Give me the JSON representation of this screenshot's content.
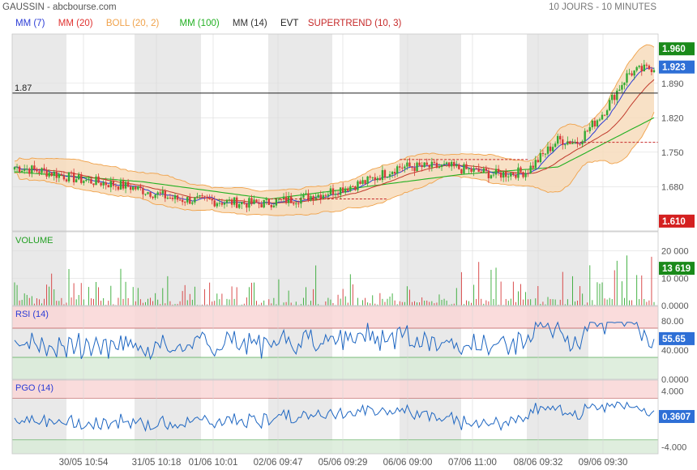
{
  "header": {
    "title": "GAUSSIN - abcbourse.com",
    "period": "10 JOURS - 10 MINUTES"
  },
  "legend": [
    {
      "label": "MM (7)",
      "color": "#2b3cd6"
    },
    {
      "label": "MM (20)",
      "color": "#e0312f"
    },
    {
      "label": "BOLL (20, 2)",
      "color": "#f0a24a"
    },
    {
      "label": "MM (100)",
      "color": "#22b022"
    },
    {
      "label": "MM (14)",
      "color": "#333333"
    },
    {
      "label": "EVT",
      "color": "#222222"
    },
    {
      "label": "SUPERTREND (10, 3)",
      "color": "#c62828"
    }
  ],
  "colors": {
    "up": "#33aa33",
    "down": "#d63a3a",
    "boll_fill": "#f7dcbc",
    "boll_line": "#f0a24a",
    "mm7": "#2b3cd6",
    "mm20": "#c0392b",
    "mm100": "#22b022",
    "indicator": "#1f67c2",
    "overbought_zone": "#f9d6d6",
    "oversold_zone": "#d9ebd8",
    "session_shade": "#e9e9e9"
  },
  "price_panel": {
    "ylim": [
      1.59,
      1.99
    ],
    "ticks": [
      "1.890",
      "1.820",
      "1.750",
      "1.680"
    ],
    "tick_values": [
      1.89,
      1.82,
      1.75,
      1.68
    ],
    "hline_label": "1.87",
    "hline_value": 1.87,
    "badges": [
      {
        "text": "1.960",
        "value": 1.96,
        "color": "#1a8a1a"
      },
      {
        "text": "1.923",
        "value": 1.923,
        "color": "#2e6fd6"
      },
      {
        "text": "1.610",
        "value": 1.61,
        "color": "#d42020"
      }
    ]
  },
  "volume_panel": {
    "label": "VOLUME",
    "ylim": [
      0,
      27000
    ],
    "ticks": [
      "20 000",
      "10 000",
      "0.0000"
    ],
    "tick_values": [
      20000,
      10000,
      0
    ],
    "badge": {
      "text": "13 619",
      "value": 13619,
      "color": "#1a8a1a"
    }
  },
  "rsi_panel": {
    "label": "RSI (14)",
    "ylim": [
      0,
      100
    ],
    "ticks": [
      "80.00",
      "40.000",
      "0.0000"
    ],
    "tick_values": [
      80,
      40,
      0
    ],
    "bands": [
      70,
      30
    ],
    "badge": {
      "text": "55.65",
      "value": 55.65,
      "color": "#2e6fd6"
    }
  },
  "pgo_panel": {
    "label": "PGO (14)",
    "ylim": [
      -5,
      5.6
    ],
    "ticks": [
      "4.000",
      "-4.000"
    ],
    "tick_values": [
      4,
      -4
    ],
    "bands": [
      3,
      -3
    ],
    "badge": {
      "text": "0.3607",
      "value": 0.3607,
      "color": "#2e6fd6"
    }
  },
  "x_labels": [
    "30/05 10:54",
    "31/05 10:18",
    "01/06 10:01",
    "02/06 09:47",
    "05/06 09:29",
    "06/06 09:00",
    "07/06 11:00",
    "08/06 09:32",
    "09/06 09:30"
  ],
  "chart_data": {
    "type": "candlestick",
    "title": "GAUSSIN - abcbourse.com",
    "ylim": [
      1.59,
      1.99
    ],
    "key_points": {
      "x_fraction": [
        0,
        0.05,
        0.1,
        0.18,
        0.25,
        0.32,
        0.38,
        0.44,
        0.48,
        0.55,
        0.6,
        0.68,
        0.75,
        0.8,
        0.85,
        0.88,
        0.92,
        0.96,
        1
      ],
      "close": [
        1.72,
        1.71,
        1.695,
        1.68,
        1.655,
        1.65,
        1.645,
        1.655,
        1.665,
        1.69,
        1.72,
        1.72,
        1.705,
        1.71,
        1.775,
        1.77,
        1.83,
        1.91,
        1.923
      ]
    },
    "mm100_points": {
      "x_fraction": [
        0,
        0.2,
        0.4,
        0.55,
        0.7,
        0.85,
        1
      ],
      "value": [
        1.71,
        1.69,
        1.655,
        1.68,
        1.705,
        1.72,
        1.82
      ]
    },
    "supertrend_levels": [
      {
        "from": 0.4,
        "to": 0.58,
        "value": 1.655
      },
      {
        "from": 0.6,
        "to": 0.8,
        "value": 1.735
      },
      {
        "from": 0.86,
        "to": 1,
        "value": 1.77
      }
    ]
  }
}
